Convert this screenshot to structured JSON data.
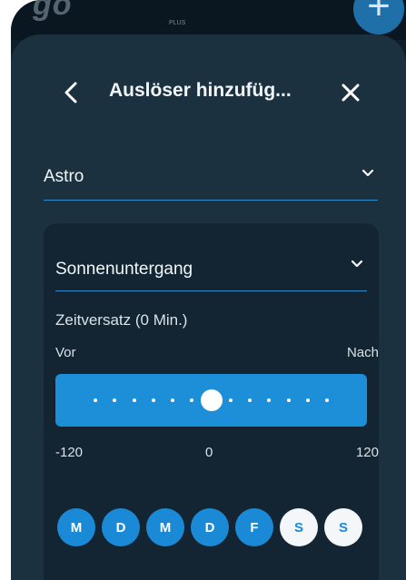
{
  "app": {
    "logo_text": "go",
    "logo_sub": "PLUS",
    "fab_label": "+"
  },
  "header": {
    "title": "Auslöser hinzufüg...",
    "back_icon": "chevron-left-icon",
    "close_icon": "close-icon"
  },
  "trigger_type": {
    "value": "Astro"
  },
  "event": {
    "value": "Sonnenuntergang"
  },
  "offset": {
    "label": "Zeitversatz (0 Min.)",
    "before_label": "Vor",
    "after_label": "Nach",
    "min": -120,
    "max": 120,
    "value": 0,
    "steps": 13,
    "ticks": [
      "-120",
      "0",
      "120"
    ]
  },
  "weekdays": [
    {
      "label": "M",
      "active": true
    },
    {
      "label": "D",
      "active": true
    },
    {
      "label": "M",
      "active": true
    },
    {
      "label": "D",
      "active": true
    },
    {
      "label": "F",
      "active": true
    },
    {
      "label": "S",
      "active": false
    },
    {
      "label": "S",
      "active": false
    }
  ],
  "colors": {
    "accent": "#1d8ed8",
    "sheet": "#1c3140",
    "card": "#132532",
    "inactive_day": "#f4f7f9"
  }
}
